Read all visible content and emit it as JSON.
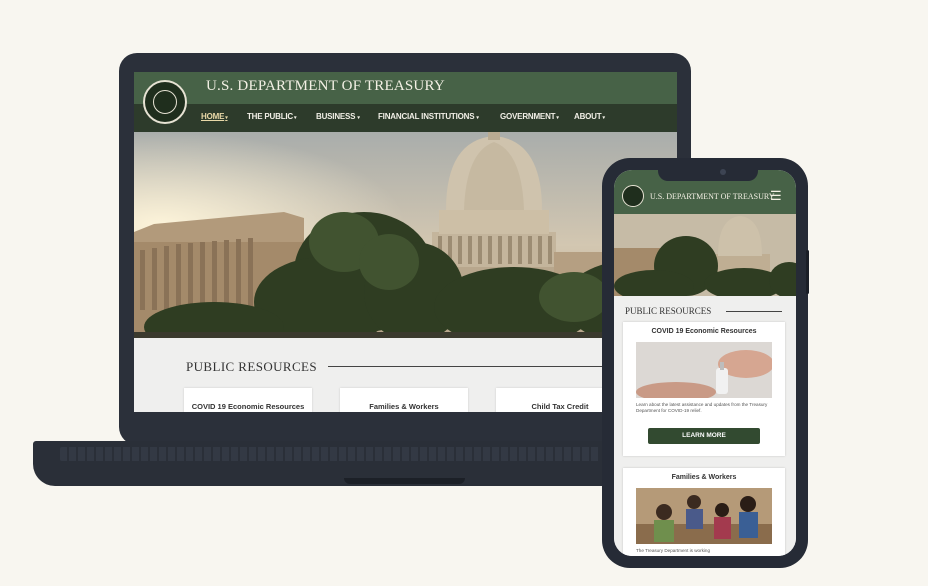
{
  "site": {
    "title": "U.S. DEPARTMENT OF TREASURY",
    "mobile_title": "U.S. DEPARTMENT OF TREASURY"
  },
  "nav": {
    "items": [
      {
        "label": "HOME",
        "caret": "▾"
      },
      {
        "label": "THE PUBLIC",
        "caret": "▾"
      },
      {
        "label": "BUSINESS",
        "caret": "▾"
      },
      {
        "label": "FINANCIAL INSTITUTIONS",
        "caret": "▾"
      },
      {
        "label": "GOVERNMENT",
        "caret": "▾"
      },
      {
        "label": "ABOUT",
        "caret": "▾"
      }
    ]
  },
  "resources": {
    "heading": "PUBLIC RESOURCES",
    "cards": [
      {
        "title": "COVID 19 Economic Resources"
      },
      {
        "title": "Families & Workers"
      },
      {
        "title": "Child Tax Credit"
      }
    ]
  },
  "mobile": {
    "heading": "PUBLIC RESOURCES",
    "menu_icon": "hamburger-menu-icon",
    "cards": [
      {
        "title": "COVID 19 Economic Resources",
        "text": "Learn about the latest assistance and updates from the Treasury Department for COVID-19 relief.",
        "button": "LEARN MORE"
      },
      {
        "title": "Families & Workers",
        "text": "The Treasury Department is working"
      }
    ]
  },
  "colors": {
    "header_green": "#476247",
    "nav_dark_green": "#2d3b2b",
    "button_green": "#324a30",
    "device_frame": "#2b303a",
    "page_background": "#f8f6f0"
  }
}
